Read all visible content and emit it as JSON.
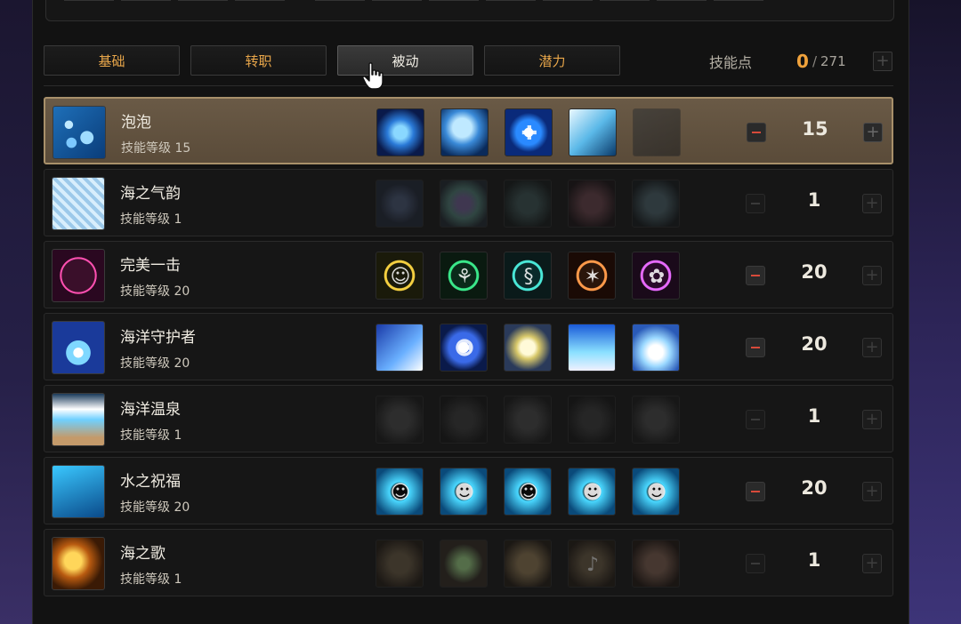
{
  "tabs": [
    {
      "label": "基础",
      "active": false
    },
    {
      "label": "转职",
      "active": false
    },
    {
      "label": "被动",
      "active": true
    },
    {
      "label": "潜力",
      "active": false
    }
  ],
  "skill_points": {
    "label": "技能点",
    "current": "0",
    "separator": "/",
    "total": "271",
    "plus_icon": "plus-icon"
  },
  "skills": [
    {
      "name": "泡泡",
      "level_text": "技能等级 15",
      "value": "15",
      "selected": true,
      "minus_enabled": true,
      "icon": "bubble-icon",
      "runes": [
        {
          "icon": "bubble-orb-icon",
          "dim": false
        },
        {
          "icon": "bubble-splash-icon",
          "dim": false
        },
        {
          "icon": "heal-cross-icon",
          "dim": false
        },
        {
          "icon": "water-wave-icon",
          "dim": false
        },
        {
          "icon": "dark-crowd-icon",
          "dim": true
        }
      ]
    },
    {
      "name": "海之气韵",
      "level_text": "技能等级 1",
      "value": "1",
      "selected": false,
      "minus_enabled": false,
      "icon": "ice-texture-icon",
      "runes": [
        {
          "icon": "swirl-icon",
          "dim": true
        },
        {
          "icon": "rainbow-orb-icon",
          "dim": true
        },
        {
          "icon": "teal-wave-icon",
          "dim": true
        },
        {
          "icon": "red-burst-icon",
          "dim": true
        },
        {
          "icon": "cyan-mist-icon",
          "dim": true
        }
      ]
    },
    {
      "name": "完美一击",
      "level_text": "技能等级 20",
      "value": "20",
      "selected": false,
      "minus_enabled": true,
      "icon": "perfect-strike-icon",
      "runes": [
        {
          "icon": "smile-badge-icon",
          "dim": false
        },
        {
          "icon": "dance-badge-icon",
          "dim": false
        },
        {
          "icon": "swirl-badge-icon",
          "dim": false
        },
        {
          "icon": "star-burst-badge-icon",
          "dim": false
        },
        {
          "icon": "flower-badge-icon",
          "dim": false
        }
      ]
    },
    {
      "name": "海洋守护者",
      "level_text": "技能等级 20",
      "value": "20",
      "selected": false,
      "minus_enabled": true,
      "icon": "ocean-guardian-icon",
      "runes": [
        {
          "icon": "wing-icon",
          "dim": false
        },
        {
          "icon": "smile-orb-icon",
          "dim": false
        },
        {
          "icon": "light-orb-icon",
          "dim": false
        },
        {
          "icon": "blue-girl-icon",
          "dim": false
        },
        {
          "icon": "white-girl-icon",
          "dim": false
        }
      ]
    },
    {
      "name": "海洋温泉",
      "level_text": "技能等级 1",
      "value": "1",
      "selected": false,
      "minus_enabled": false,
      "icon": "hot-spring-icon",
      "runes": [
        {
          "icon": "gray-splash-icon",
          "dim": true
        },
        {
          "icon": "silhouette-icon",
          "dim": true
        },
        {
          "icon": "gray-wave-icon",
          "dim": true
        },
        {
          "icon": "gray-crowd-icon",
          "dim": true
        },
        {
          "icon": "gray-mist-icon",
          "dim": true
        }
      ]
    },
    {
      "name": "水之祝福",
      "level_text": "技能等级 20",
      "value": "20",
      "selected": false,
      "minus_enabled": true,
      "icon": "water-blessing-icon",
      "runes": [
        {
          "icon": "leap-figure-icon",
          "dim": false
        },
        {
          "icon": "flex-figure-icon",
          "dim": false
        },
        {
          "icon": "run-figure-icon",
          "dim": false
        },
        {
          "icon": "cheer-figure-icon",
          "dim": false
        },
        {
          "icon": "power-figure-icon",
          "dim": false
        }
      ]
    },
    {
      "name": "海之歌",
      "level_text": "技能等级 1",
      "value": "1",
      "selected": false,
      "minus_enabled": false,
      "icon": "sea-song-icon",
      "runes": [
        {
          "icon": "hand-icon",
          "dim": true
        },
        {
          "icon": "glowstick-icon",
          "dim": true
        },
        {
          "icon": "clap-icon",
          "dim": true
        },
        {
          "icon": "music-note-icon",
          "dim": true
        },
        {
          "icon": "wave-hand-icon",
          "dim": true
        }
      ]
    }
  ]
}
